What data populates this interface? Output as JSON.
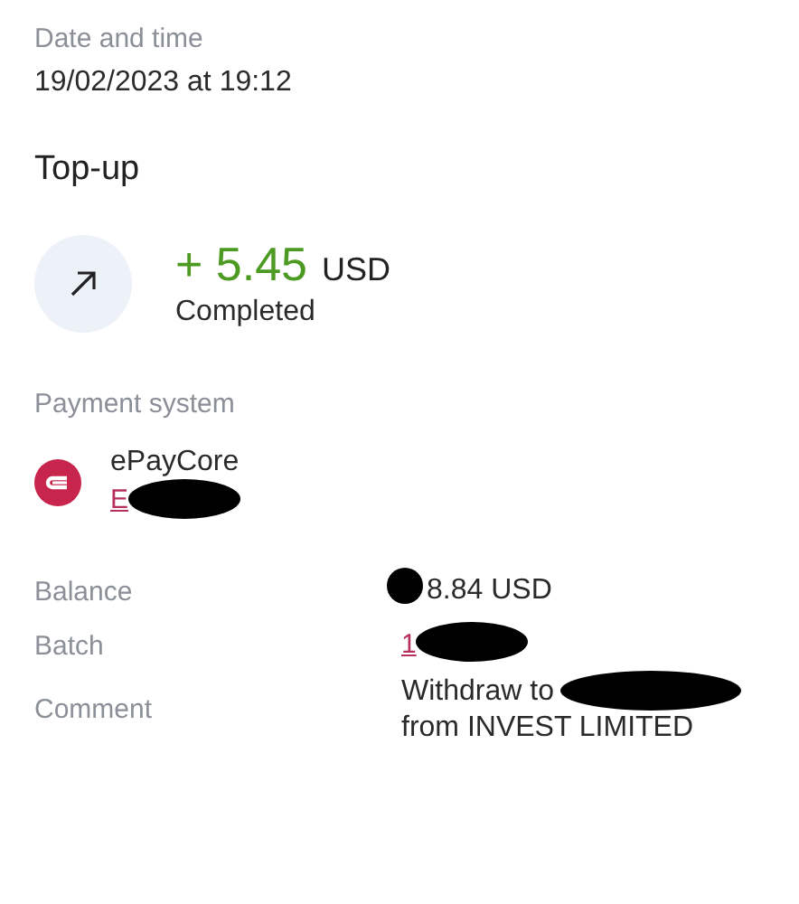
{
  "date_label": "Date and time",
  "date_value": "19/02/2023 at 19:12",
  "title": "Top-up",
  "amount": {
    "sign_value": "+ 5.45",
    "currency": "USD",
    "status": "Completed"
  },
  "payment_system": {
    "label": "Payment system",
    "name": "ePayCore",
    "account": "E",
    "redacted": true
  },
  "details": [
    {
      "label": "Balance",
      "kind": "text",
      "lines": [
        "8.84 USD"
      ],
      "redacted": true
    },
    {
      "label": "Batch",
      "kind": "link",
      "lines": [
        "1"
      ],
      "redacted": true
    },
    {
      "label": "Comment",
      "kind": "text",
      "lines": [
        "Withdraw to",
        "from INVEST LIMITED"
      ],
      "redacted": true
    }
  ]
}
